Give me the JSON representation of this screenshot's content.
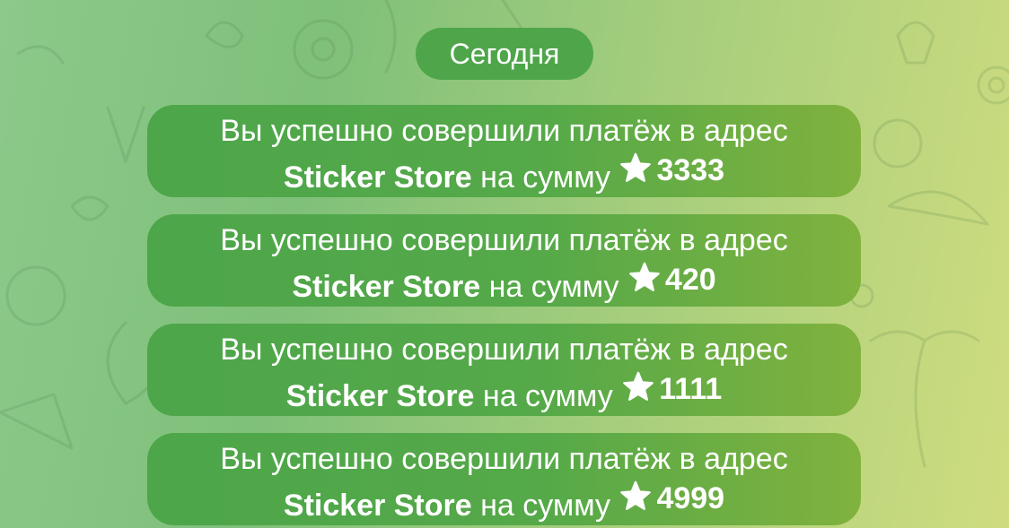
{
  "chat": {
    "date_label": "Сегодня",
    "messages": [
      {
        "prefix": "Вы успешно совершили платёж в адрес",
        "recipient": "Sticker Store",
        "middle": "на сумму",
        "amount": "3333"
      },
      {
        "prefix": "Вы успешно совершили платёж в адрес",
        "recipient": "Sticker Store",
        "middle": "на сумму",
        "amount": "420"
      },
      {
        "prefix": "Вы успешно совершили платёж в адрес",
        "recipient": "Sticker Store",
        "middle": "на сумму",
        "amount": "1111"
      },
      {
        "prefix": "Вы успешно совершили платёж в адрес",
        "recipient": "Sticker Store",
        "middle": "на сумму",
        "amount": "4999"
      }
    ]
  },
  "theme": {
    "bubble_color": "#4fa64a",
    "text_color": "#ffffff",
    "background_left": "#8cc98a",
    "background_right": "#cfdc7f"
  },
  "icons": {
    "amount_icon": "star-icon"
  }
}
